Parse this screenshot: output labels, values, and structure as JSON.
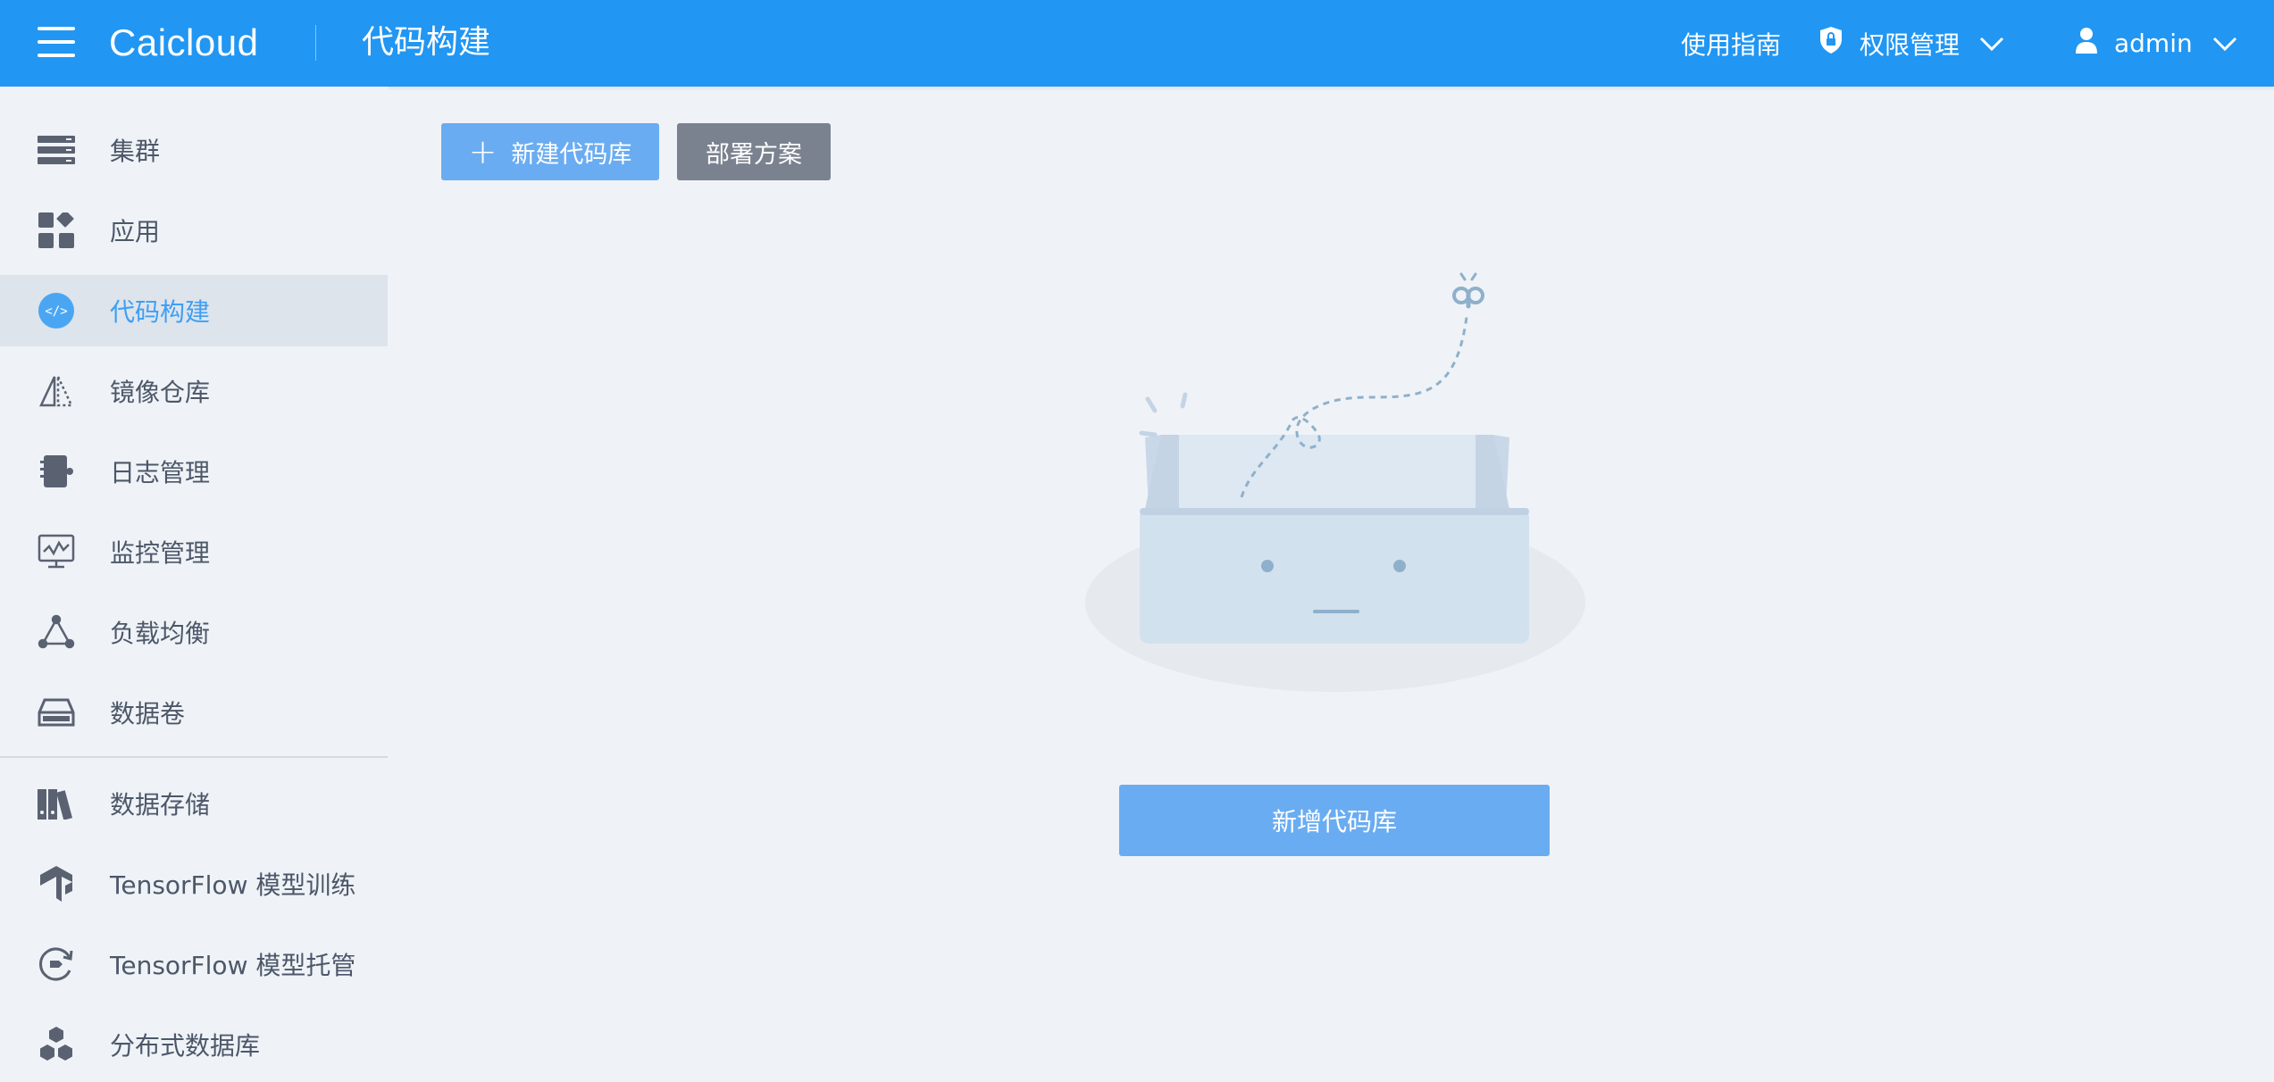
{
  "header": {
    "logo": "Caicloud",
    "page_title": "代码构建",
    "guide": "使用指南",
    "permission": "权限管理",
    "user": "admin"
  },
  "sidebar": {
    "items": [
      {
        "label": "集群",
        "icon": "server-icon"
      },
      {
        "label": "应用",
        "icon": "apps-icon"
      },
      {
        "label": "代码构建",
        "icon": "code-icon",
        "active": true
      },
      {
        "label": "镜像仓库",
        "icon": "image-repo-icon"
      },
      {
        "label": "日志管理",
        "icon": "log-icon"
      },
      {
        "label": "监控管理",
        "icon": "monitor-icon"
      },
      {
        "label": "负载均衡",
        "icon": "load-balance-icon"
      },
      {
        "label": "数据卷",
        "icon": "volume-icon"
      },
      {
        "label": "数据存储",
        "icon": "storage-icon"
      },
      {
        "label": "TensorFlow 模型训练",
        "icon": "tensorflow-icon"
      },
      {
        "label": "TensorFlow 模型托管",
        "icon": "model-hosting-icon"
      },
      {
        "label": "分布式数据库",
        "icon": "database-icon"
      }
    ]
  },
  "main": {
    "new_repo_button": "新建代码库",
    "deploy_button": "部署方案",
    "add_repo_button": "新增代码库"
  },
  "colors": {
    "header": "#2196f3",
    "background": "#eff3f7",
    "primary_button": "#6aacf1",
    "secondary_button": "#7b828f",
    "active_text": "#3f9ef4"
  }
}
